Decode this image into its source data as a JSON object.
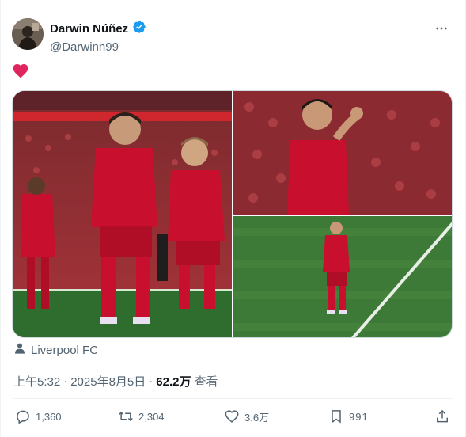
{
  "author": {
    "name": "Darwin Núñez",
    "handle": "@Darwinn99",
    "verified": true
  },
  "tweet": {
    "text_emoji": "red-heart",
    "media_count": 3,
    "location": "Liverpool FC"
  },
  "meta": {
    "time": "上午5:32",
    "separator": "·",
    "date": "2025年8月5日",
    "views": "62.2万",
    "views_label": "查看"
  },
  "actions": {
    "replies": "1,360",
    "retweets": "2,304",
    "likes": "3.6万",
    "bookmarks": "991"
  },
  "colors": {
    "accent": "#1d9bf0",
    "heart": "#e0245e",
    "muted": "#536471",
    "kit_red": "#c8102e"
  }
}
